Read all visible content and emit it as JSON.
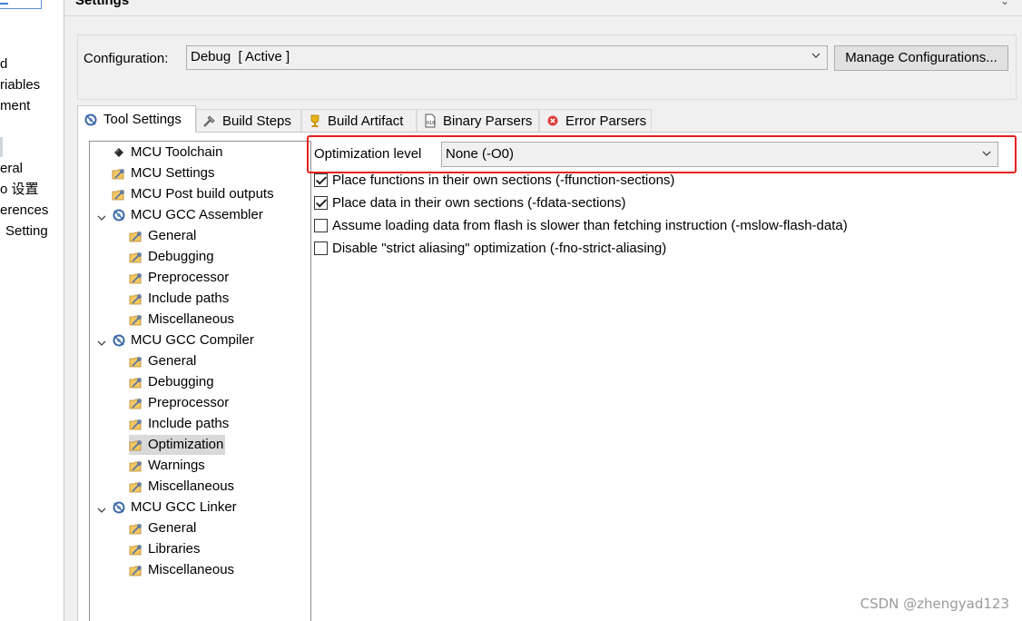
{
  "left_nav": {
    "items": [
      "d",
      "riables",
      "ment",
      "eral",
      "o 设置",
      "erences",
      "Setting"
    ]
  },
  "page": {
    "title": "Settings"
  },
  "configuration": {
    "label": "Configuration:",
    "value": "Debug  [ Active ]",
    "manage_button": "Manage Configurations..."
  },
  "tabs": [
    {
      "label": "Tool Settings",
      "icon": "tool-settings-icon",
      "active": true
    },
    {
      "label": "Build Steps",
      "icon": "build-steps-icon"
    },
    {
      "label": "Build Artifact",
      "icon": "trophy-icon"
    },
    {
      "label": "Binary Parsers",
      "icon": "binary-icon"
    },
    {
      "label": "Error Parsers",
      "icon": "error-icon"
    }
  ],
  "tree": {
    "nodes": [
      {
        "label": "MCU Toolchain",
        "level": 0,
        "icon": "chip-icon"
      },
      {
        "label": "MCU Settings",
        "level": 0,
        "icon": "settings-folder-icon"
      },
      {
        "label": "MCU Post build outputs",
        "level": 0,
        "icon": "settings-folder-icon"
      },
      {
        "label": "MCU GCC Assembler",
        "level": 0,
        "icon": "tool-icon",
        "expanded": true
      },
      {
        "label": "General",
        "level": 1,
        "icon": "settings-folder-icon"
      },
      {
        "label": "Debugging",
        "level": 1,
        "icon": "settings-folder-icon"
      },
      {
        "label": "Preprocessor",
        "level": 1,
        "icon": "settings-folder-icon"
      },
      {
        "label": "Include paths",
        "level": 1,
        "icon": "settings-folder-icon"
      },
      {
        "label": "Miscellaneous",
        "level": 1,
        "icon": "settings-folder-icon"
      },
      {
        "label": "MCU GCC Compiler",
        "level": 0,
        "icon": "tool-icon",
        "expanded": true
      },
      {
        "label": "General",
        "level": 1,
        "icon": "settings-folder-icon"
      },
      {
        "label": "Debugging",
        "level": 1,
        "icon": "settings-folder-icon"
      },
      {
        "label": "Preprocessor",
        "level": 1,
        "icon": "settings-folder-icon"
      },
      {
        "label": "Include paths",
        "level": 1,
        "icon": "settings-folder-icon"
      },
      {
        "label": "Optimization",
        "level": 1,
        "icon": "settings-folder-icon",
        "selected": true
      },
      {
        "label": "Warnings",
        "level": 1,
        "icon": "settings-folder-icon"
      },
      {
        "label": "Miscellaneous",
        "level": 1,
        "icon": "settings-folder-icon"
      },
      {
        "label": "MCU GCC Linker",
        "level": 0,
        "icon": "tool-icon",
        "expanded": true
      },
      {
        "label": "General",
        "level": 1,
        "icon": "settings-folder-icon"
      },
      {
        "label": "Libraries",
        "level": 1,
        "icon": "settings-folder-icon"
      },
      {
        "label": "Miscellaneous",
        "level": 1,
        "icon": "settings-folder-icon"
      }
    ]
  },
  "optimization": {
    "label": "Optimization level",
    "value": "None (-O0)",
    "highlight_color": "#e51f1f",
    "options": [
      {
        "label": "Place functions in their own sections (-ffunction-sections)",
        "checked": true
      },
      {
        "label": "Place data in their own sections (-fdata-sections)",
        "checked": true
      },
      {
        "label": "Assume loading data from flash is slower than fetching instruction (-mslow-flash-data)",
        "checked": false
      },
      {
        "label": "Disable \"strict aliasing\" optimization (-fno-strict-aliasing)",
        "checked": false
      }
    ]
  },
  "watermark": "CSDN @zhengyad123"
}
